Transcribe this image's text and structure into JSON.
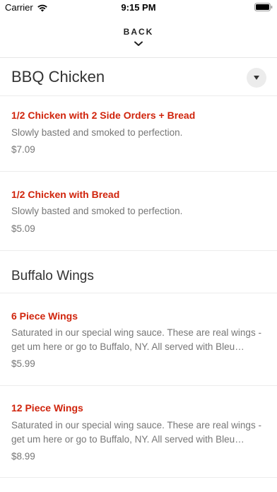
{
  "status_bar": {
    "carrier": "Carrier",
    "time": "9:15 PM",
    "icons": [
      "wifi-icon",
      "battery-icon"
    ]
  },
  "nav": {
    "back_label": "BACK",
    "back_icon": "chevron-down-icon"
  },
  "category": {
    "title": "BBQ Chicken",
    "dropdown_icon": "caret-down-icon"
  },
  "bbq_items": [
    {
      "name": "1/2 Chicken with 2 Side Orders + Bread",
      "description": "Slowly basted and smoked to perfection.",
      "price": "$7.09"
    },
    {
      "name": "1/2 Chicken with Bread",
      "description": "Slowly basted and smoked to perfection.",
      "price": "$5.09"
    }
  ],
  "section": {
    "title": "Buffalo Wings"
  },
  "wing_items": [
    {
      "name": "6 Piece Wings",
      "description": "Saturated in our special wing sauce. These are real wings - get um here or go to Buffalo, NY. All served with Bleu cheese dressing.",
      "price": "$5.99"
    },
    {
      "name": "12 Piece Wings",
      "description": "Saturated in our special wing sauce. These are real wings - get um here or go to Buffalo, NY. All served with Bleu cheese dressing.",
      "price": "$8.99"
    }
  ],
  "colors": {
    "item_name": "#d0240c",
    "text_secondary": "#777777",
    "divider": "#ececec"
  }
}
